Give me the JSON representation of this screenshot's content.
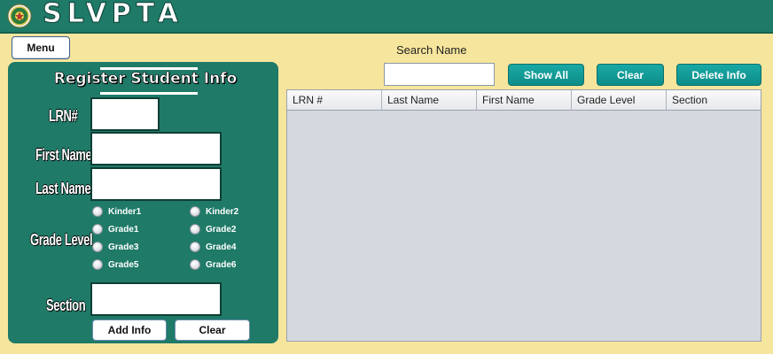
{
  "app": {
    "title": "SLVPTA",
    "logo_icon": "school-seal-icon"
  },
  "menu": {
    "label": "Menu"
  },
  "register": {
    "title": "Register Student Info",
    "labels": {
      "lrn": "LRN#",
      "first_name": "First Name",
      "last_name": "Last Name",
      "grade_level": "Grade Level",
      "section": "Section"
    },
    "values": {
      "lrn": "",
      "first_name": "",
      "last_name": "",
      "section": ""
    },
    "grade_options": [
      "Kinder1",
      "Kinder2",
      "Grade1",
      "Grade2",
      "Grade3",
      "Grade4",
      "Grade5",
      "Grade6"
    ],
    "add_button": "Add Info",
    "clear_button": "Clear"
  },
  "search": {
    "label": "Search Name",
    "value": "",
    "show_all_button": "Show All",
    "clear_button": "Clear",
    "delete_button": "Delete Info"
  },
  "table": {
    "columns": [
      "LRN #",
      "Last Name",
      "First Name",
      "Grade Level",
      "Section"
    ],
    "rows": []
  },
  "colors": {
    "background": "#f6e59c",
    "panel": "#1f7a68",
    "accent_button": "#1aa9a5",
    "table_bg": "#d5d8df"
  }
}
